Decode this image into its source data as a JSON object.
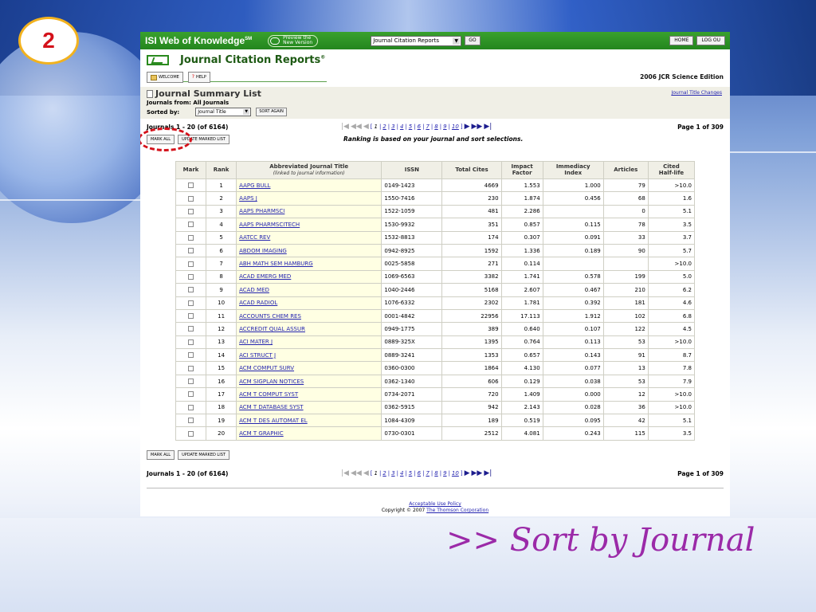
{
  "slide": {
    "number": "2",
    "caption": ">> Sort by Journal"
  },
  "header": {
    "brand": "ISI Web of Knowledge",
    "brand_sup": "SM",
    "preview_line1": "Preview the",
    "preview_line2": "New Version",
    "db_select": "Journal Citation Reports",
    "go": "GO",
    "home": "HOME",
    "logout": "LOG OU"
  },
  "jcr": {
    "title": "Journal Citation Reports",
    "title_sup": "®",
    "welcome": "WELCOME",
    "help": "HELP",
    "edition": "2006 JCR Science Edition"
  },
  "summary": {
    "title": "Journal Summary List",
    "changes_link": "Journal Title Changes",
    "from_label": "Journals from:",
    "from_value": "All Journals",
    "sorted_label": "Sorted by:",
    "sorted_value": "Journal Title",
    "sort_again": "SORT AGAIN"
  },
  "pager": {
    "count": "Journals 1 - 20 (of 6164)",
    "page_of": "Page 1 of 309",
    "pages": [
      "1",
      "2",
      "3",
      "4",
      "5",
      "6",
      "7",
      "8",
      "9",
      "10"
    ],
    "mark_all": "MARK ALL",
    "update_marked": "UPDATE MARKED LIST",
    "ranking_note": "Ranking is based on your journal and sort selections."
  },
  "table": {
    "headers": {
      "mark": "Mark",
      "rank": "Rank",
      "title": "Abbreviated Journal Title",
      "title_sub": "(linked to journal information)",
      "issn": "ISSN",
      "total_cites": "Total Cites",
      "impact_1": "Impact",
      "impact_2": "Factor",
      "immediacy_1": "Immediacy",
      "immediacy_2": "Index",
      "articles": "Articles",
      "cited_1": "Cited",
      "cited_2": "Half-life"
    },
    "rows": [
      {
        "rank": "1",
        "title": "AAPG BULL",
        "issn": "0149-1423",
        "cites": "4669",
        "impact": "1.553",
        "immediacy": "1.000",
        "articles": "79",
        "halflife": ">10.0"
      },
      {
        "rank": "2",
        "title": "AAPS J",
        "issn": "1550-7416",
        "cites": "230",
        "impact": "1.874",
        "immediacy": "0.456",
        "articles": "68",
        "halflife": "1.6"
      },
      {
        "rank": "3",
        "title": "AAPS PHARMSCI",
        "issn": "1522-1059",
        "cites": "481",
        "impact": "2.286",
        "immediacy": "",
        "articles": "0",
        "halflife": "5.1"
      },
      {
        "rank": "4",
        "title": "AAPS PHARMSCITECH",
        "issn": "1530-9932",
        "cites": "351",
        "impact": "0.857",
        "immediacy": "0.115",
        "articles": "78",
        "halflife": "3.5"
      },
      {
        "rank": "5",
        "title": "AATCC REV",
        "issn": "1532-8813",
        "cites": "174",
        "impact": "0.307",
        "immediacy": "0.091",
        "articles": "33",
        "halflife": "3.7"
      },
      {
        "rank": "6",
        "title": "ABDOM IMAGING",
        "issn": "0942-8925",
        "cites": "1592",
        "impact": "1.336",
        "immediacy": "0.189",
        "articles": "90",
        "halflife": "5.7"
      },
      {
        "rank": "7",
        "title": "ABH MATH SEM HAMBURG",
        "issn": "0025-5858",
        "cites": "271",
        "impact": "0.114",
        "immediacy": "",
        "articles": "",
        "halflife": ">10.0"
      },
      {
        "rank": "8",
        "title": "ACAD EMERG MED",
        "issn": "1069-6563",
        "cites": "3382",
        "impact": "1.741",
        "immediacy": "0.578",
        "articles": "199",
        "halflife": "5.0"
      },
      {
        "rank": "9",
        "title": "ACAD MED",
        "issn": "1040-2446",
        "cites": "5168",
        "impact": "2.607",
        "immediacy": "0.467",
        "articles": "210",
        "halflife": "6.2"
      },
      {
        "rank": "10",
        "title": "ACAD RADIOL",
        "issn": "1076-6332",
        "cites": "2302",
        "impact": "1.781",
        "immediacy": "0.392",
        "articles": "181",
        "halflife": "4.6"
      },
      {
        "rank": "11",
        "title": "ACCOUNTS CHEM RES",
        "issn": "0001-4842",
        "cites": "22956",
        "impact": "17.113",
        "immediacy": "1.912",
        "articles": "102",
        "halflife": "6.8"
      },
      {
        "rank": "12",
        "title": "ACCREDIT QUAL ASSUR",
        "issn": "0949-1775",
        "cites": "389",
        "impact": "0.640",
        "immediacy": "0.107",
        "articles": "122",
        "halflife": "4.5"
      },
      {
        "rank": "13",
        "title": "ACI MATER J",
        "issn": "0889-325X",
        "cites": "1395",
        "impact": "0.764",
        "immediacy": "0.113",
        "articles": "53",
        "halflife": ">10.0"
      },
      {
        "rank": "14",
        "title": "ACI STRUCT J",
        "issn": "0889-3241",
        "cites": "1353",
        "impact": "0.657",
        "immediacy": "0.143",
        "articles": "91",
        "halflife": "8.7"
      },
      {
        "rank": "15",
        "title": "ACM COMPUT SURV",
        "issn": "0360-0300",
        "cites": "1864",
        "impact": "4.130",
        "immediacy": "0.077",
        "articles": "13",
        "halflife": "7.8"
      },
      {
        "rank": "16",
        "title": "ACM SIGPLAN NOTICES",
        "issn": "0362-1340",
        "cites": "606",
        "impact": "0.129",
        "immediacy": "0.038",
        "articles": "53",
        "halflife": "7.9"
      },
      {
        "rank": "17",
        "title": "ACM T COMPUT SYST",
        "issn": "0734-2071",
        "cites": "720",
        "impact": "1.409",
        "immediacy": "0.000",
        "articles": "12",
        "halflife": ">10.0"
      },
      {
        "rank": "18",
        "title": "ACM T DATABASE SYST",
        "issn": "0362-5915",
        "cites": "942",
        "impact": "2.143",
        "immediacy": "0.028",
        "articles": "36",
        "halflife": ">10.0"
      },
      {
        "rank": "19",
        "title": "ACM T DES AUTOMAT EL",
        "issn": "1084-4309",
        "cites": "189",
        "impact": "0.519",
        "immediacy": "0.095",
        "articles": "42",
        "halflife": "5.1"
      },
      {
        "rank": "20",
        "title": "ACM T GRAPHIC",
        "issn": "0730-0301",
        "cites": "2512",
        "impact": "4.081",
        "immediacy": "0.243",
        "articles": "115",
        "halflife": "3.5"
      }
    ]
  },
  "footer": {
    "acceptable_use": "Acceptable Use Policy",
    "copyright": "Copyright © 2007",
    "corp": "The Thomson Corporation"
  }
}
